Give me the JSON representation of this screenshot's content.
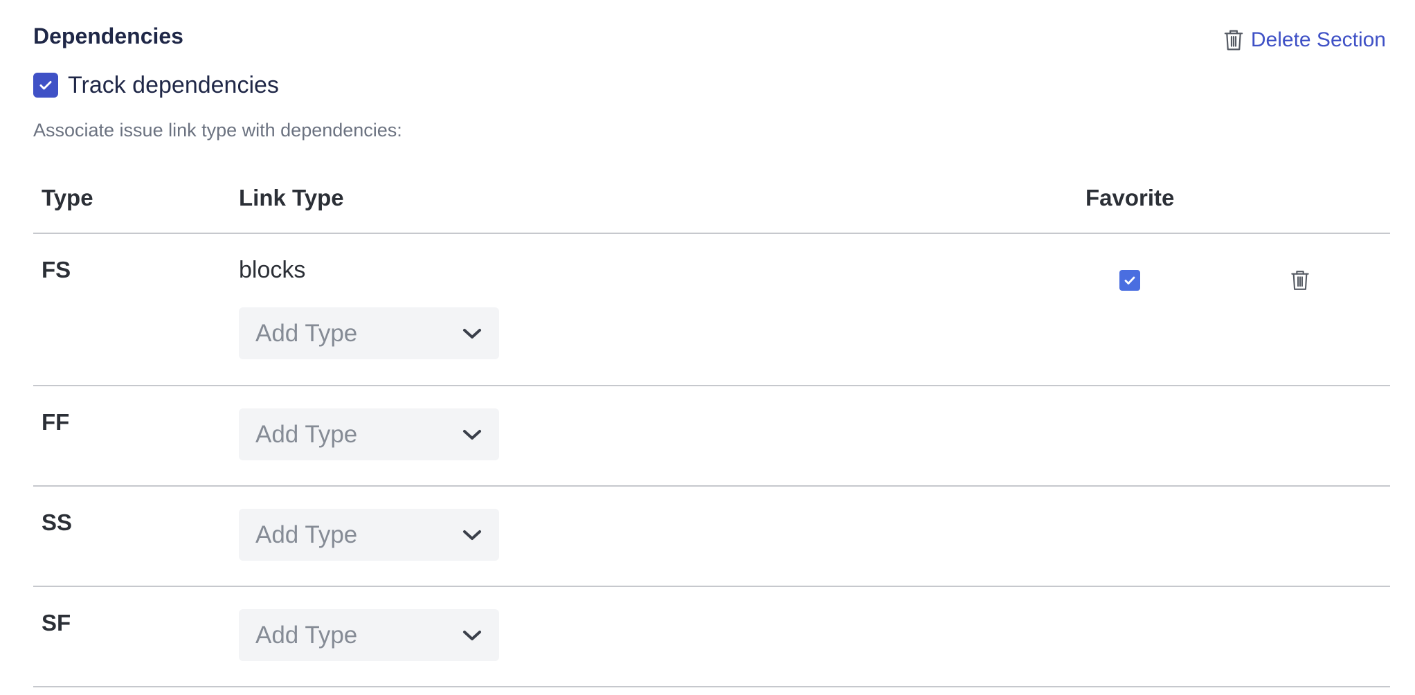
{
  "section": {
    "title": "Dependencies",
    "delete_label": "Delete Section",
    "delete_icon": "trash-icon"
  },
  "track": {
    "label": "Track dependencies",
    "checked": true
  },
  "helper_text": "Associate issue link type with dependencies:",
  "table": {
    "headers": {
      "type": "Type",
      "link_type": "Link Type",
      "favorite": "Favorite"
    },
    "rows": [
      {
        "type": "FS",
        "link_value": "blocks",
        "select_placeholder": "Add Type",
        "favorite": true
      },
      {
        "type": "FF",
        "select_placeholder": "Add Type"
      },
      {
        "type": "SS",
        "select_placeholder": "Add Type"
      },
      {
        "type": "SF",
        "select_placeholder": "Add Type"
      }
    ]
  },
  "colors": {
    "accent": "#3f51c6",
    "favorite_check": "#4a6ee0",
    "select_bg": "#f3f4f6",
    "divider": "#c6c8cd"
  }
}
